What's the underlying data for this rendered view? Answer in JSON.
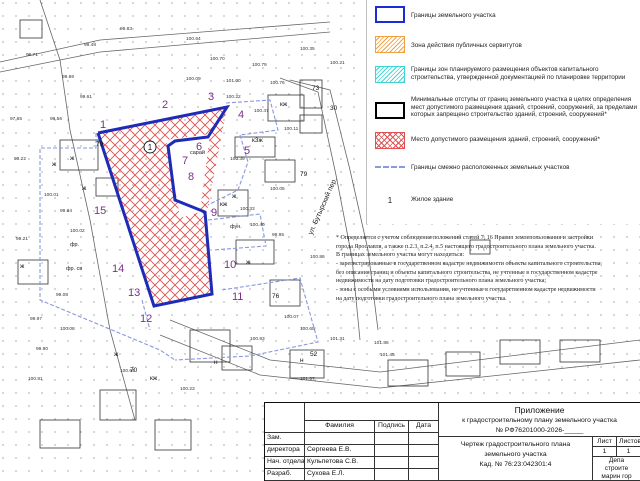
{
  "legend": [
    {
      "label": "Границы земельного участка",
      "swatch": "boundary",
      "color": "#1b2bd6"
    },
    {
      "label": "Зона действия публичных сервитутов",
      "swatch": "hatch-orange",
      "color": "#f0a040"
    },
    {
      "label": "Границы зон планируемого размещения объектов капитального строительства, утвержденной документацией по планировке территории",
      "swatch": "hatch-cyan",
      "color": "#3fd3d3"
    },
    {
      "label": "Минимальные отступы от границ земельного участка в целях определения мест допустимого размещения зданий, строений, сооружений, за пределами которых запрещено строительство зданий, строений, сооружений*",
      "swatch": "black-box",
      "color": "#000000"
    },
    {
      "label": "Место допустимого размещения зданий, строений, сооружений*",
      "swatch": "hatch-red",
      "color": "#e05050"
    },
    {
      "label": "Границы смежно расположенных земельных участков",
      "swatch": "dashed",
      "color": "#8899dd"
    },
    {
      "label": "Жилое здание",
      "swatch": "number",
      "number": "1"
    }
  ],
  "notes": [
    "* Определяется с учетом соблюдения положений статей 7, 16 Правил землепользования и застройки",
    "города Ярославля, а также п.2.3, п.2.4, п.5 настоящего градостроительного плана земельного участка.",
    "В границах земельного участка могут находиться:",
    "- зарегистрированные в государственном кадастре недвижимости объекты капитального строительства,",
    "без описания границ и объекты капитального строительства, не учтенные в государственном кадастре",
    "недвижимости на дату подготовки градостроительного плана земельного участка;",
    "- зоны с особыми условиями использования, не учтенные в государственном кадастре недвижимости",
    "на дату подготовки градостроительного плана земельного участка."
  ],
  "stamp": {
    "headers": [
      "Фамилия",
      "Подпись",
      "Дата"
    ],
    "rows": [
      {
        "role": "Зам.",
        "name": "",
        "sign": "",
        "date": ""
      },
      {
        "role": "директора",
        "name": "Сергеева  Е.В.",
        "sign": "",
        "date": ""
      },
      {
        "role": "Нач. отдела",
        "name": "Кульпетова С.В.",
        "sign": "",
        "date": ""
      },
      {
        "role": "Разраб.",
        "name": "Сухова Е.Л.",
        "sign": "",
        "date": ""
      }
    ],
    "appendix_title": "Приложение",
    "appendix_line2": "к градостроительному плану земельного участка",
    "appendix_number": "№ РФ76201000-2026-_____",
    "drawing_title": "Чертеж градостроительного плана",
    "drawing_title2": "земельного участка",
    "cadastral": "Кад. № 76:23:042301:4",
    "sheet_label": "Лист",
    "sheets_label": "Листов",
    "sheet_value": "1",
    "sheets_value": "1",
    "dept_line1": "Депа",
    "dept_line2": "строите",
    "dept_line3": "марин гор"
  },
  "map": {
    "street_label": "ул. Бутырский пер.",
    "plot_number": "1",
    "point_labels": [
      "1",
      "2",
      "3",
      "4",
      "5",
      "6",
      "7",
      "8",
      "9",
      "10",
      "11",
      "12",
      "13",
      "14",
      "15"
    ],
    "elevations": [
      "99.71",
      "99.98",
      "99.61",
      "99.48",
      "99.83",
      "100.64",
      "100.70",
      "100.79",
      "100.35",
      "100.21",
      "100.22",
      "100.47",
      "100.11",
      "100.39",
      "100.05",
      "100.33",
      "100.40",
      "99.95",
      "100.86",
      "100.07",
      "100.65",
      "100.93",
      "101.31",
      "101.86",
      "101.45",
      "101.57",
      "100.23",
      "100.64",
      "99.08",
      "99.97",
      "100.08",
      "99.90",
      "100.81",
      "99.21",
      "99.94",
      "100.02",
      "100.01",
      "97.65",
      "99.56",
      "99.22",
      "100.09",
      "101.00",
      "100.76"
    ],
    "building_marks": [
      "ж",
      "ж",
      "ж",
      "ж",
      "ж",
      "ж",
      "ж",
      "н",
      "н",
      "кж",
      "кж",
      "кж",
      "к3ж",
      "73",
      "70",
      "79",
      "79",
      "76",
      "30",
      "52"
    ],
    "object_labels": [
      "сарай",
      "фун.",
      "фр.",
      "фр. св"
    ],
    "colors": {
      "boundary": "#1e2bb6",
      "hatch": "#e05050",
      "neighbor": "#8a97e0"
    }
  }
}
